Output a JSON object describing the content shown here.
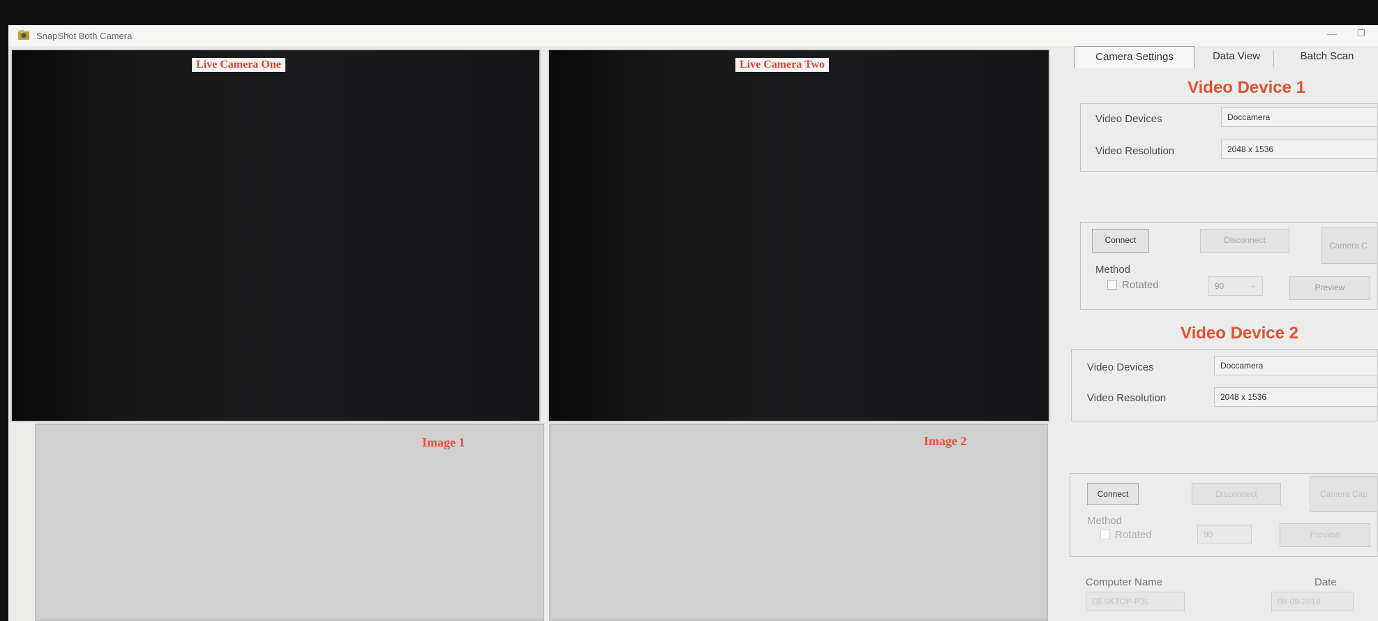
{
  "window": {
    "title": "SnapShot Both Camera",
    "minimize_symbol": "—",
    "maximize_symbol": "❐"
  },
  "panels": {
    "live_camera_one": "Live Camera One",
    "live_camera_two": "Live Camera Two",
    "image_1": "Image 1",
    "image_2": "Image 2"
  },
  "tabs": [
    "Camera Settings",
    "Data View",
    "Batch Scan"
  ],
  "device1": {
    "title": "Video Device 1",
    "video_devices_label": "Video Devices",
    "video_devices_value": "Doccamera",
    "video_resolution_label": "Video Resolution",
    "video_resolution_value": "2048 x 1536",
    "connect_label": "Connect",
    "disconnect_label": "Disconnect",
    "camera_label": "Camera C",
    "method_label": "Method",
    "rotated_label": "Rotated",
    "rotation_value": "90",
    "preview_label": "Preview"
  },
  "device2": {
    "title": "Video Device 2",
    "video_devices_label": "Video Devices",
    "video_devices_value": "Doccamera",
    "video_resolution_label": "Video Resolution",
    "video_resolution_value": "2048 x 1536",
    "connect_label": "Connect",
    "disconnect_label": "Disconnect",
    "camera_label": "Camera Cap",
    "method_label": "Method",
    "rotated_label": "Rotated",
    "rotation_value": "90",
    "preview_label": "Preview"
  },
  "footer": {
    "computer_name_label": "Computer Name",
    "computer_name_value": "DESKTOP-P3L",
    "date_label": "Date",
    "date_value": "08-09-2018"
  },
  "colors": {
    "accent": "#e0522f",
    "live_panel": "#161617",
    "image_panel": "#cfd0cf"
  },
  "icons": [
    "app-icon",
    "dropdown-arrow-icon"
  ]
}
